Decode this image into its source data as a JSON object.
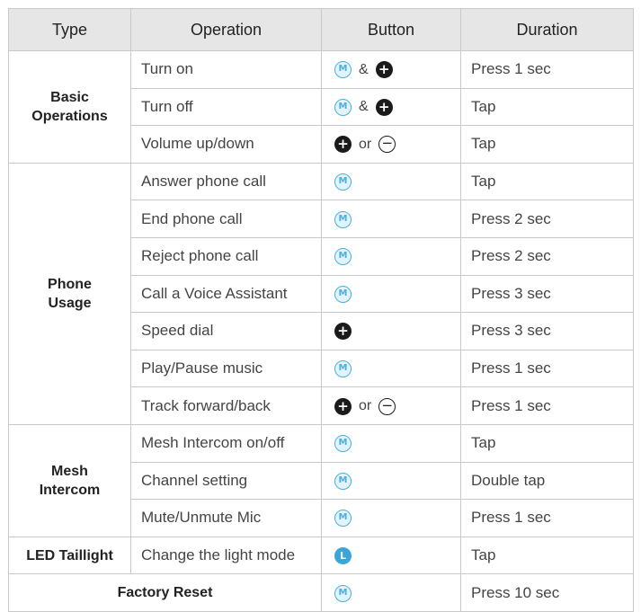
{
  "headers": {
    "type": "Type",
    "operation": "Operation",
    "button": "Button",
    "duration": "Duration"
  },
  "groups": {
    "basic": "Basic Operations",
    "phone": "Phone Usage",
    "mesh": "Mesh Intercom",
    "led": "LED Taillight",
    "factory": "Factory Reset"
  },
  "conj": {
    "and": "&",
    "or": "or"
  },
  "icons": {
    "m": "M",
    "plus": "+",
    "minus": "−",
    "l": "L"
  },
  "rows": [
    {
      "operation": "Turn on",
      "duration": "Press 1 sec"
    },
    {
      "operation": "Turn off",
      "duration": "Tap"
    },
    {
      "operation": "Volume up/down",
      "duration": "Tap"
    },
    {
      "operation": "Answer phone call",
      "duration": "Tap"
    },
    {
      "operation": "End phone call",
      "duration": "Press 2 sec"
    },
    {
      "operation": "Reject phone call",
      "duration": "Press 2 sec"
    },
    {
      "operation": "Call a Voice Assistant",
      "duration": "Press 3 sec"
    },
    {
      "operation": "Speed dial",
      "duration": "Press 3 sec"
    },
    {
      "operation": "Play/Pause music",
      "duration": "Press 1 sec"
    },
    {
      "operation": "Track forward/back",
      "duration": "Press 1 sec"
    },
    {
      "operation": "Mesh Intercom on/off",
      "duration": "Tap"
    },
    {
      "operation": "Channel setting",
      "duration": "Double tap"
    },
    {
      "operation": "Mute/Unmute Mic",
      "duration": "Press 1 sec"
    },
    {
      "operation": "Change the light mode",
      "duration": "Tap"
    },
    {
      "duration": "Press 10 sec"
    }
  ],
  "colors": {
    "header_bg": "#e6e6e6",
    "border": "#c9c9c9",
    "m_icon": "#4ab0dd",
    "l_icon": "#3aa6d8"
  }
}
